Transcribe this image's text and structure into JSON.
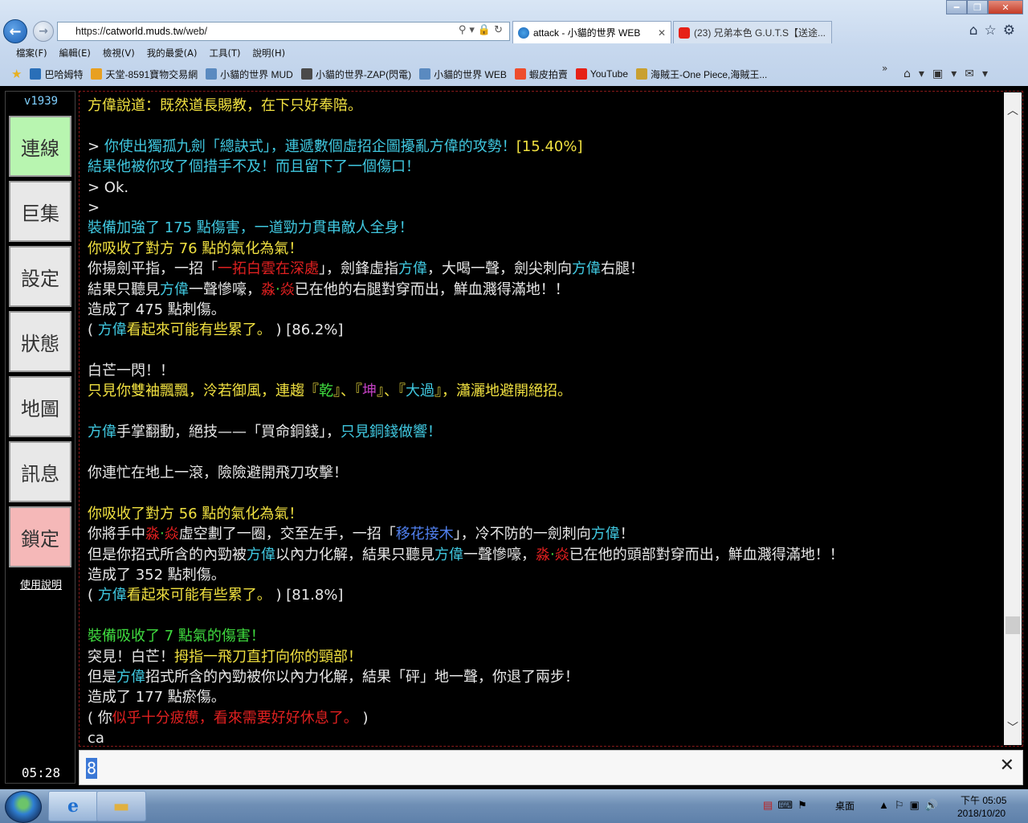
{
  "browser": {
    "url_scheme": "https://",
    "url_host": "catworld.muds.tw",
    "url_path": "/web/",
    "tabs": [
      {
        "title": "attack - 小貓的世界 WEB",
        "close": "✕"
      },
      {
        "title": "(23) 兄弟本色 G.U.T.S【送途...",
        "close": ""
      }
    ],
    "menu": [
      "檔案(F)",
      "編輯(E)",
      "檢視(V)",
      "我的最愛(A)",
      "工具(T)",
      "說明(H)"
    ],
    "favorites": [
      {
        "label": "巴哈姆特",
        "color": "#2a6fb8"
      },
      {
        "label": "天堂-8591寶物交易網",
        "color": "#e8a020"
      },
      {
        "label": "小貓的世界 MUD",
        "color": "#5a8ac0"
      },
      {
        "label": "小貓的世界-ZAP(閃電)",
        "color": "#4a4a4a"
      },
      {
        "label": "小貓的世界 WEB",
        "color": "#5a8ac0"
      },
      {
        "label": "蝦皮拍賣",
        "color": "#ee4d2d"
      },
      {
        "label": "YouTube",
        "color": "#e62117"
      },
      {
        "label": "海賊王-One Piece,海賊王...",
        "color": "#c9a030"
      }
    ],
    "overflow": "»"
  },
  "sidebar": {
    "version": "v1939",
    "buttons": [
      {
        "label": "連線",
        "bg": "#b8f5b0"
      },
      {
        "label": "巨集",
        "bg": "#e8e8e8"
      },
      {
        "label": "設定",
        "bg": "#e8e8e8"
      },
      {
        "label": "狀態",
        "bg": "#e8e8e8"
      },
      {
        "label": "地圖",
        "bg": "#e8e8e8"
      },
      {
        "label": "訊息",
        "bg": "#e8e8e8"
      },
      {
        "label": "鎖定",
        "bg": "#f5b8b8"
      }
    ],
    "help": "使用說明",
    "clock": "05:28"
  },
  "colors": {
    "yellow": "#f0e040",
    "cyan": "#40c8e0",
    "green": "#40e040",
    "white": "#e8e8e8",
    "red": "#e02020",
    "magenta": "#c040c0",
    "blue": "#5080f0",
    "lime": "#3fdc3f"
  },
  "output": [
    [
      {
        "t": "方偉說道：既然道長賜教，在下只好奉陪。",
        "c": "yellow"
      }
    ],
    [],
    [
      {
        "t": "> ",
        "c": "white"
      },
      {
        "t": "你使出獨孤九劍「總訣式」，連遞數個虛招企圖擾亂方偉的攻勢！",
        "c": "cyan"
      },
      {
        "t": "[15.40%]",
        "c": "yellow"
      }
    ],
    [
      {
        "t": "結果他被你攻了個措手不及！而且留下了一個傷口！",
        "c": "cyan"
      }
    ],
    [
      {
        "t": "> Ok.",
        "c": "white"
      }
    ],
    [
      {
        "t": ">",
        "c": "white"
      }
    ],
    [
      {
        "t": "裝備加強了 175 點傷害，一道勁力貫串敵人全身！",
        "c": "cyan"
      }
    ],
    [
      {
        "t": "你吸收了對方 76 點的氣化為氣！",
        "c": "yellow"
      }
    ],
    [
      {
        "t": "你揚劍平指，一招「",
        "c": "white"
      },
      {
        "t": "一拓白雲在深處",
        "c": "red"
      },
      {
        "t": "」，劍鋒虛指",
        "c": "white"
      },
      {
        "t": "方偉",
        "c": "cyan"
      },
      {
        "t": "，大喝一聲，劍尖刺向",
        "c": "white"
      },
      {
        "t": "方偉",
        "c": "cyan"
      },
      {
        "t": "右腿！",
        "c": "white"
      }
    ],
    [
      {
        "t": "結果只聽見",
        "c": "white"
      },
      {
        "t": "方偉",
        "c": "cyan"
      },
      {
        "t": "一聲慘嚎，",
        "c": "white"
      },
      {
        "t": "淼",
        "c": "red"
      },
      {
        "t": "‧",
        "c": "green"
      },
      {
        "t": "焱",
        "c": "red"
      },
      {
        "t": "已在他的右腿對穿而出，鮮血濺得滿地！！",
        "c": "white"
      }
    ],
    [
      {
        "t": "造成了 475 點刺傷。",
        "c": "white"
      }
    ],
    [
      {
        "t": "( ",
        "c": "white"
      },
      {
        "t": "方偉",
        "c": "cyan"
      },
      {
        "t": "看起來可能有些累了。",
        "c": "yellow"
      },
      {
        "t": " ) [86.2%]",
        "c": "white"
      }
    ],
    [],
    [
      {
        "t": "白芒一閃！！",
        "c": "white"
      }
    ],
    [
      {
        "t": "只見你雙袖飄飄，泠若御風，連趨『",
        "c": "yellow"
      },
      {
        "t": "乾",
        "c": "green"
      },
      {
        "t": "』、『",
        "c": "yellow"
      },
      {
        "t": "坤",
        "c": "magenta"
      },
      {
        "t": "』、『",
        "c": "yellow"
      },
      {
        "t": "大過",
        "c": "cyan"
      },
      {
        "t": "』，瀟灑地避開絕招。",
        "c": "yellow"
      }
    ],
    [],
    [
      {
        "t": "方偉",
        "c": "cyan"
      },
      {
        "t": "手掌翻動，絕技——「買命銅錢」，",
        "c": "white"
      },
      {
        "t": "只見銅錢做響！",
        "c": "cyan"
      }
    ],
    [],
    [
      {
        "t": "你連忙在地上一滾，險險避開飛刀攻擊！",
        "c": "white"
      }
    ],
    [],
    [
      {
        "t": "你吸收了對方 56 點的氣化為氣！",
        "c": "yellow"
      }
    ],
    [
      {
        "t": "你將手中",
        "c": "white"
      },
      {
        "t": "淼",
        "c": "red"
      },
      {
        "t": "‧",
        "c": "green"
      },
      {
        "t": "焱",
        "c": "red"
      },
      {
        "t": "虛空劃了一圈，交至左手，一招「",
        "c": "white"
      },
      {
        "t": "移花接木",
        "c": "blue"
      },
      {
        "t": "」，冷不防的一劍刺向",
        "c": "white"
      },
      {
        "t": "方偉",
        "c": "cyan"
      },
      {
        "t": "！",
        "c": "white"
      }
    ],
    [
      {
        "t": "但是你招式所含的內勁被",
        "c": "white"
      },
      {
        "t": "方偉",
        "c": "cyan"
      },
      {
        "t": "以內力化解，結果只聽見",
        "c": "white"
      },
      {
        "t": "方偉",
        "c": "cyan"
      },
      {
        "t": "一聲慘嚎，",
        "c": "white"
      },
      {
        "t": "淼",
        "c": "red"
      },
      {
        "t": "‧",
        "c": "green"
      },
      {
        "t": "焱",
        "c": "red"
      },
      {
        "t": "已在他的頭部對穿而出，鮮血濺得滿地！！",
        "c": "white"
      }
    ],
    [
      {
        "t": "造成了 352 點刺傷。",
        "c": "white"
      }
    ],
    [
      {
        "t": "( ",
        "c": "white"
      },
      {
        "t": "方偉",
        "c": "cyan"
      },
      {
        "t": "看起來可能有些累了。",
        "c": "yellow"
      },
      {
        "t": " ) [81.8%]",
        "c": "white"
      }
    ],
    [],
    [
      {
        "t": "裝備吸收了 7 點氣的傷害！",
        "c": "lime"
      }
    ],
    [
      {
        "t": "突見！白芒！",
        "c": "white"
      },
      {
        "t": "拇指一飛刀直打向你的頸部！",
        "c": "yellow"
      }
    ],
    [
      {
        "t": "但是",
        "c": "white"
      },
      {
        "t": "方偉",
        "c": "cyan"
      },
      {
        "t": "招式所含的內勁被你以內力化解，結果「砰」地一聲，你退了兩步！",
        "c": "white"
      }
    ],
    [
      {
        "t": "造成了 177 點瘀傷。",
        "c": "white"
      }
    ],
    [
      {
        "t": "( 你",
        "c": "white"
      },
      {
        "t": "似乎十分疲憊，看來需要好好休息了。",
        "c": "red"
      },
      {
        "t": " )",
        "c": "white"
      }
    ],
    [
      {
        "t": "ca",
        "c": "white"
      }
    ]
  ],
  "input": {
    "value": "8",
    "clear": "✕"
  },
  "taskbar": {
    "desktop": "桌面",
    "time": "下午 05:05",
    "date": "2018/10/20"
  }
}
